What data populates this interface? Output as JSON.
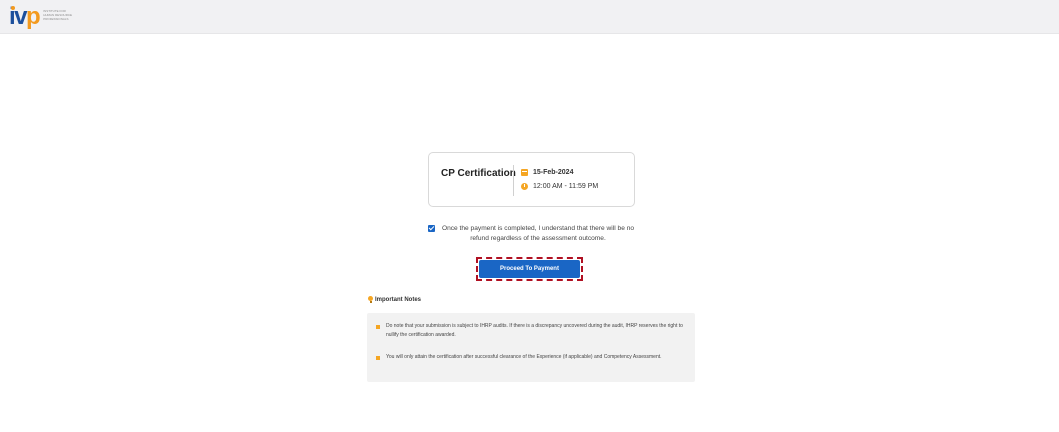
{
  "header": {
    "logo_mark_left": "iv",
    "logo_mark_right": "p",
    "logo_text_lines": [
      "INSTITUTE FOR",
      "HUMAN RESOURCE",
      "PROFESSIONALS"
    ]
  },
  "event": {
    "title": "CP Certification",
    "date": "15-Feb-2024",
    "time": "12:00 AM - 11:59 PM"
  },
  "agreement": {
    "checked": true,
    "text": "Once the payment is completed, I understand that there will be no refund regardless of the assessment outcome."
  },
  "proceed_button": {
    "label": "Proceed To Payment"
  },
  "important_notes": {
    "heading": "Important Notes",
    "items": [
      "Do note that your submission is subject to IHRP audits. If there is a discrepancy uncovered during the audit, IHRP reserves the right to nullify the certification awarded.",
      "You will only attain the certification after successful clearance of the Experience (if applicable) and Competency Assessment."
    ]
  },
  "colors": {
    "brand_blue": "#1c4f9c",
    "brand_orange": "#f39a1e",
    "button_blue": "#1a66c5",
    "highlight_red": "#b01022",
    "notes_bg": "#f2f2f2"
  }
}
